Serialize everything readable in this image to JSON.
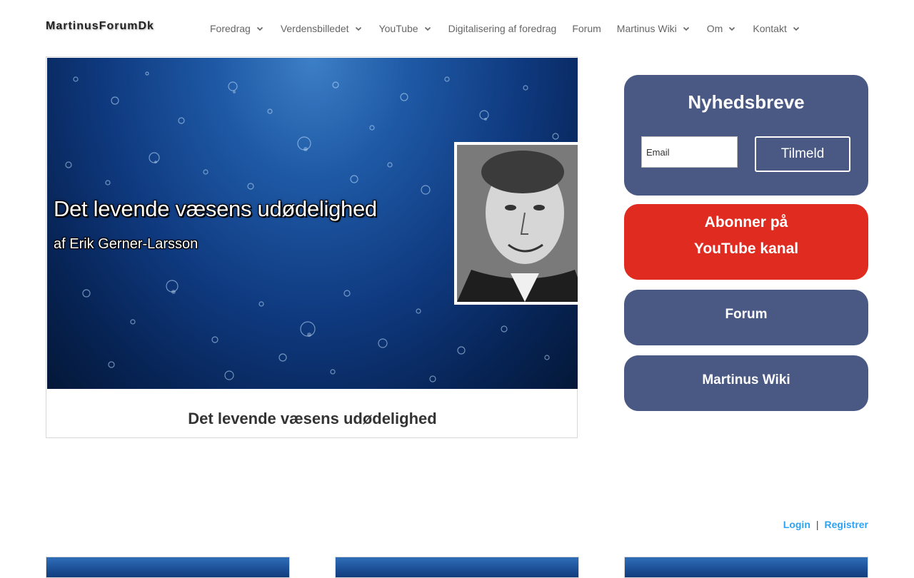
{
  "site": {
    "logo": "MartinusForumDk"
  },
  "nav": {
    "items": [
      {
        "label": "Foredrag",
        "has_dropdown": true
      },
      {
        "label": "Verdensbilledet",
        "has_dropdown": true
      },
      {
        "label": "YouTube",
        "has_dropdown": true
      },
      {
        "label": "Digitalisering af foredrag",
        "has_dropdown": false
      },
      {
        "label": "Forum",
        "has_dropdown": false
      },
      {
        "label": "Martinus Wiki",
        "has_dropdown": true
      },
      {
        "label": "Om",
        "has_dropdown": true
      },
      {
        "label": "Kontakt",
        "has_dropdown": true
      }
    ]
  },
  "featured": {
    "thumb_title": "Det levende væsens udødelighed",
    "thumb_author": "af Erik Gerner-Larsson",
    "title": "Det levende væsens udødelighed"
  },
  "sidebar": {
    "newsletter": {
      "title": "Nyhedsbreve",
      "email_placeholder": "Email",
      "button": "Tilmeld"
    },
    "youtube": {
      "line1": "Abonner på",
      "line2": "YouTube kanal"
    },
    "forum": {
      "label": "Forum"
    },
    "wiki": {
      "label": "Martinus Wiki"
    }
  },
  "auth": {
    "login": "Login",
    "separator": "|",
    "register": "Registrer"
  },
  "colors": {
    "widget_blue": "#4a5984",
    "widget_red": "#e02b20",
    "link_blue": "#2ea3f2",
    "thumb_blue": "#0f3a80"
  }
}
